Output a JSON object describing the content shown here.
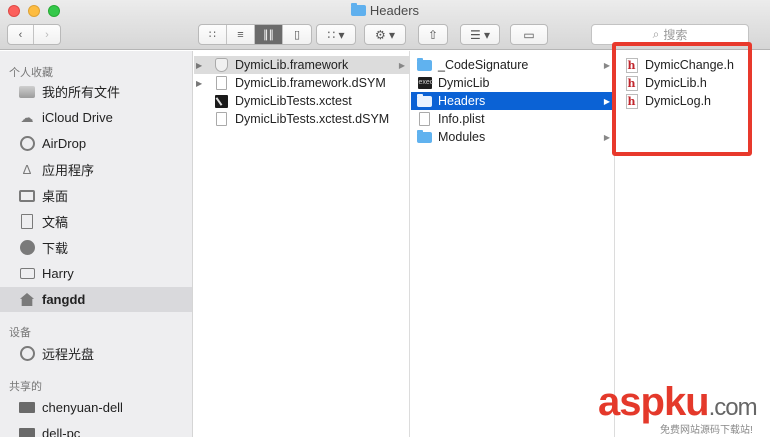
{
  "window": {
    "title": "Headers"
  },
  "toolbar": {
    "search_placeholder": "搜索",
    "back_icon": "chevron-left",
    "forward_icon": "chevron-right",
    "view_icons": [
      "icon-view",
      "list-view",
      "column-view",
      "cover-flow-view"
    ],
    "arrange_icon": "arrange",
    "action_icon": "gear",
    "share_icon": "share",
    "sort_icon": "sort-lines",
    "tag_icon": "tag"
  },
  "sidebar": {
    "favorites_header": "个人收藏",
    "favorites": [
      {
        "label": "我的所有文件",
        "icon": "all-files"
      },
      {
        "label": "iCloud Drive",
        "icon": "cloud"
      },
      {
        "label": "AirDrop",
        "icon": "airdrop"
      },
      {
        "label": "应用程序",
        "icon": "applications"
      },
      {
        "label": "桌面",
        "icon": "desktop"
      },
      {
        "label": "文稿",
        "icon": "documents"
      },
      {
        "label": "下载",
        "icon": "downloads"
      },
      {
        "label": "Harry",
        "icon": "folder"
      },
      {
        "label": "fangdd",
        "icon": "home"
      }
    ],
    "selected": "fangdd",
    "devices_header": "设备",
    "devices": [
      {
        "label": "远程光盘",
        "icon": "remote-disc"
      }
    ],
    "shared_header": "共享的",
    "shared": [
      {
        "label": "chenyuan-dell",
        "icon": "pc"
      },
      {
        "label": "dell-pc",
        "icon": "pc"
      }
    ]
  },
  "columns": [
    {
      "items": [
        {
          "name": "DymicLib.framework",
          "kind": "framework",
          "selected": "grey",
          "has_children": true,
          "expandable": true
        },
        {
          "name": "DymicLib.framework.dSYM",
          "kind": "doc",
          "expandable": true
        },
        {
          "name": "DymicLibTests.xctest",
          "kind": "xctest"
        },
        {
          "name": "DymicLibTests.xctest.dSYM",
          "kind": "doc"
        }
      ]
    },
    {
      "items": [
        {
          "name": "_CodeSignature",
          "kind": "folder",
          "has_children": true
        },
        {
          "name": "DymicLib",
          "kind": "exec"
        },
        {
          "name": "Headers",
          "kind": "folder",
          "selected": "blue",
          "has_children": true
        },
        {
          "name": "Info.plist",
          "kind": "doc"
        },
        {
          "name": "Modules",
          "kind": "folder",
          "has_children": true
        }
      ]
    },
    {
      "items": [
        {
          "name": "DymicChange.h",
          "kind": "header"
        },
        {
          "name": "DymicLib.h",
          "kind": "header"
        },
        {
          "name": "DymicLog.h",
          "kind": "header"
        }
      ]
    }
  ],
  "annotation_color": "#e8392c",
  "selection_color": "#0b62d5",
  "watermark": {
    "asp": "asp",
    "ku": "ku",
    "domain": ".com",
    "sub": "免费网站源码下载站!"
  }
}
